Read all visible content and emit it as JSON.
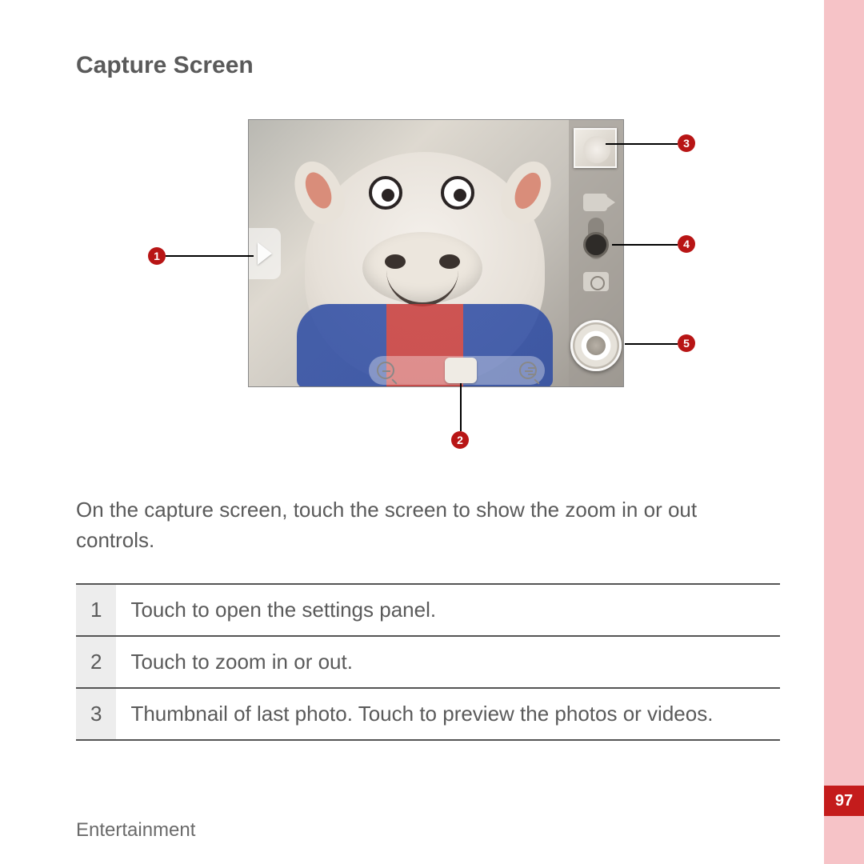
{
  "section_title": "Capture Screen",
  "intro_text": "On the capture screen, touch the screen to show the zoom in or out controls.",
  "callouts": {
    "c1": "1",
    "c2": "2",
    "c3": "3",
    "c4": "4",
    "c5": "5"
  },
  "legend": [
    {
      "num": "1",
      "desc": "Touch to open the settings panel."
    },
    {
      "num": "2",
      "desc": "Touch to zoom in or out."
    },
    {
      "num": "3",
      "desc": "Thumbnail of last photo. Touch to preview the photos or videos."
    }
  ],
  "footer": "Entertainment",
  "page_number": "97"
}
